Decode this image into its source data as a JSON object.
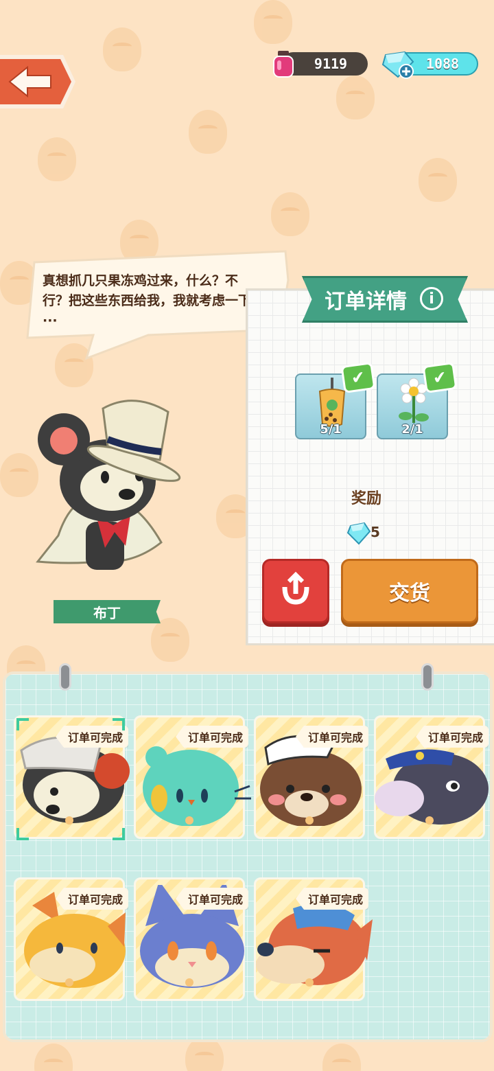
{
  "currency": {
    "ink": "9119",
    "gems": "1088"
  },
  "dialogue": {
    "text": "真想抓几只果冻鸡过来，什么？不行？把这些东西给我，我就考虑一下···"
  },
  "character": {
    "name": "布丁"
  },
  "order": {
    "title": "订单详情",
    "info_symbol": "i",
    "requirements": [
      {
        "item": "bubble-tea",
        "count": "5/1",
        "complete": true
      },
      {
        "item": "daisy-flower",
        "count": "2/1",
        "complete": true
      }
    ],
    "reward_label": "奖励",
    "reward_amount": "5",
    "deliver_label": "交货"
  },
  "customers": [
    {
      "name": "pudding-mouse",
      "badge": "订单可完成",
      "selected": true
    },
    {
      "name": "teal-bird",
      "badge": "订单可完成",
      "selected": false
    },
    {
      "name": "brown-bear",
      "badge": "订单可完成",
      "selected": false
    },
    {
      "name": "hippo-police",
      "badge": "订单可完成",
      "selected": false
    },
    {
      "name": "orange-cat",
      "badge": "订单可完成",
      "selected": false
    },
    {
      "name": "blue-cat",
      "badge": "订单可完成",
      "selected": false
    },
    {
      "name": "red-dog",
      "badge": "订单可完成",
      "selected": false
    }
  ],
  "colors": {
    "background": "#fde3c4",
    "panel_header": "#43a184",
    "deliver_button": "#eb9638",
    "undo_button": "#e2413d",
    "board": "#c9ece6"
  }
}
